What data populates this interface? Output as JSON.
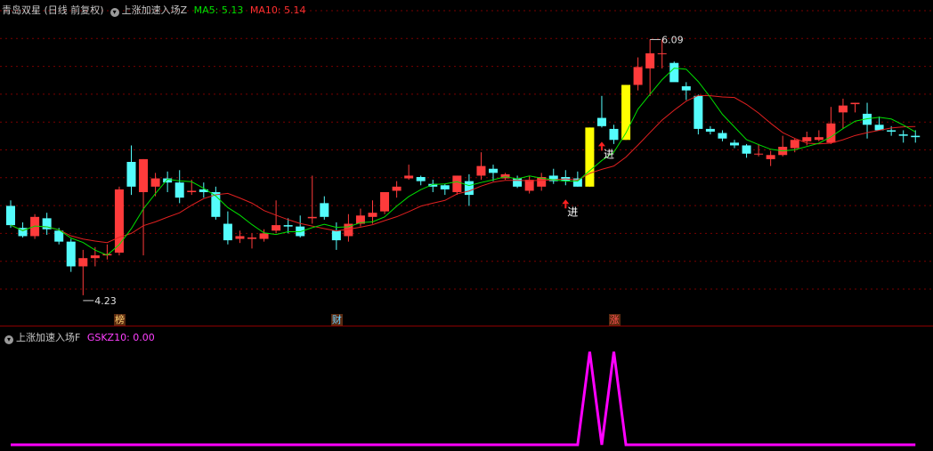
{
  "header": {
    "main_title": "青岛双星 (日线 前复权)",
    "indicator_name": "上涨加速入场Z",
    "ma5_label": "MA5: 5.13",
    "ma10_label": "MA10: 5.14"
  },
  "sub_header": {
    "indicator_name": "上涨加速入场F",
    "value_label": "GSKZ10: 0.00"
  },
  "event_badges": [
    {
      "label": "榜",
      "index": 9,
      "color": "#ffd070"
    },
    {
      "label": "财",
      "index": 27,
      "color": "#6ad0ff"
    },
    {
      "label": "涨",
      "index": 50,
      "color": "#ff5050"
    }
  ],
  "signals": {
    "entry_text": "进",
    "entry_indices": [
      46,
      49
    ]
  },
  "colors": {
    "up": "#ff3b3b",
    "down": "#54fcfc",
    "highlight": "#ffff00",
    "ma5": "#00e000",
    "ma10": "#e02020",
    "grid": "#7a0000",
    "sub_line": "#ff00ff"
  },
  "chart_data": [
    {
      "type": "candlestick",
      "series": [
        {
          "name": "price",
          "ohlc": [
            [
              4.88,
              4.92,
              4.72,
              4.74
            ],
            [
              4.72,
              4.76,
              4.65,
              4.66
            ],
            [
              4.66,
              4.82,
              4.64,
              4.8
            ],
            [
              4.79,
              4.83,
              4.67,
              4.71
            ],
            [
              4.7,
              4.72,
              4.6,
              4.62
            ],
            [
              4.62,
              4.64,
              4.4,
              4.44
            ],
            [
              4.44,
              4.56,
              4.23,
              4.5
            ],
            [
              4.5,
              4.58,
              4.44,
              4.52
            ],
            [
              4.52,
              4.6,
              4.49,
              4.53
            ],
            [
              4.54,
              5.02,
              4.52,
              5.0
            ],
            [
              5.2,
              5.32,
              4.96,
              5.02
            ],
            [
              4.98,
              5.22,
              4.52,
              5.22
            ],
            [
              5.02,
              5.12,
              4.95,
              5.08
            ],
            [
              5.08,
              5.13,
              4.98,
              5.05
            ],
            [
              5.05,
              5.14,
              4.9,
              4.94
            ],
            [
              4.98,
              5.07,
              4.96,
              4.99
            ],
            [
              5.0,
              5.05,
              4.94,
              4.98
            ],
            [
              4.98,
              5.02,
              4.78,
              4.8
            ],
            [
              4.75,
              4.84,
              4.6,
              4.63
            ],
            [
              4.64,
              4.7,
              4.61,
              4.66
            ],
            [
              4.64,
              4.68,
              4.57,
              4.65
            ],
            [
              4.64,
              4.71,
              4.62,
              4.68
            ],
            [
              4.7,
              4.92,
              4.68,
              4.74
            ],
            [
              4.74,
              4.79,
              4.68,
              4.73
            ],
            [
              4.73,
              4.81,
              4.65,
              4.66
            ],
            [
              4.79,
              5.1,
              4.75,
              4.8
            ],
            [
              4.9,
              4.95,
              4.78,
              4.8
            ],
            [
              4.7,
              4.76,
              4.56,
              4.63
            ],
            [
              4.66,
              4.82,
              4.62,
              4.75
            ],
            [
              4.75,
              4.86,
              4.73,
              4.81
            ],
            [
              4.8,
              4.92,
              4.75,
              4.83
            ],
            [
              4.84,
              4.98,
              4.82,
              4.98
            ],
            [
              4.99,
              5.06,
              4.94,
              5.02
            ],
            [
              5.08,
              5.18,
              5.07,
              5.1
            ],
            [
              5.09,
              5.1,
              5.03,
              5.06
            ],
            [
              5.04,
              5.07,
              4.98,
              5.02
            ],
            [
              5.03,
              5.04,
              4.96,
              5.0
            ],
            [
              4.98,
              5.1,
              4.96,
              5.1
            ],
            [
              5.06,
              5.11,
              4.88,
              4.96
            ],
            [
              5.1,
              5.27,
              5.07,
              5.17
            ],
            [
              5.15,
              5.18,
              5.06,
              5.12
            ],
            [
              5.08,
              5.12,
              5.07,
              5.11
            ],
            [
              5.08,
              5.1,
              5.01,
              5.02
            ],
            [
              4.99,
              5.1,
              4.97,
              5.07
            ],
            [
              5.02,
              5.12,
              4.99,
              5.09
            ],
            [
              5.1,
              5.15,
              5.04,
              5.06
            ],
            [
              5.09,
              5.14,
              5.03,
              5.06
            ],
            [
              5.08,
              5.13,
              5.02,
              5.02
            ],
            [
              5.02,
              5.45,
              5.02,
              5.45
            ],
            [
              5.52,
              5.68,
              5.45,
              5.46
            ],
            [
              5.44,
              5.47,
              5.33,
              5.36
            ],
            [
              5.36,
              5.76,
              5.36,
              5.76
            ],
            [
              5.76,
              5.96,
              5.72,
              5.89
            ],
            [
              5.88,
              6.09,
              5.68,
              5.99
            ],
            [
              5.99,
              6.09,
              5.88,
              5.99
            ],
            [
              5.92,
              5.93,
              5.81,
              5.78
            ],
            [
              5.75,
              5.78,
              5.65,
              5.72
            ],
            [
              5.68,
              5.69,
              5.4,
              5.44
            ],
            [
              5.44,
              5.46,
              5.4,
              5.42
            ],
            [
              5.41,
              5.43,
              5.35,
              5.37
            ],
            [
              5.34,
              5.36,
              5.3,
              5.32
            ],
            [
              5.32,
              5.33,
              5.23,
              5.26
            ],
            [
              5.26,
              5.33,
              5.24,
              5.26
            ],
            [
              5.22,
              5.28,
              5.17,
              5.25
            ],
            [
              5.25,
              5.39,
              5.24,
              5.31
            ],
            [
              5.3,
              5.37,
              5.27,
              5.36
            ],
            [
              5.35,
              5.42,
              5.32,
              5.38
            ],
            [
              5.36,
              5.43,
              5.35,
              5.38
            ],
            [
              5.34,
              5.6,
              5.33,
              5.48
            ],
            [
              5.56,
              5.66,
              5.44,
              5.61
            ],
            [
              5.62,
              5.63,
              5.56,
              5.63
            ],
            [
              5.55,
              5.63,
              5.37,
              5.47
            ],
            [
              5.47,
              5.53,
              5.43,
              5.43
            ],
            [
              5.43,
              5.46,
              5.39,
              5.42
            ],
            [
              5.4,
              5.43,
              5.34,
              5.39
            ],
            [
              5.39,
              5.43,
              5.34,
              5.38
            ]
          ]
        },
        {
          "name": "MA5",
          "values": []
        },
        {
          "name": "MA10",
          "values": []
        }
      ],
      "annotations": [
        {
          "text": "4.23",
          "index": 6
        },
        {
          "text": "6.09",
          "index": 53
        }
      ],
      "ylim": [
        4.1,
        6.3
      ]
    },
    {
      "type": "line",
      "series": [
        {
          "name": "GSKZ10",
          "values": [
            0,
            0,
            0,
            0,
            0,
            0,
            0,
            0,
            0,
            0,
            0,
            0,
            0,
            0,
            0,
            0,
            0,
            0,
            0,
            0,
            0,
            0,
            0,
            0,
            0,
            0,
            0,
            0,
            0,
            0,
            0,
            0,
            0,
            0,
            0,
            0,
            0,
            0,
            0,
            0,
            0,
            0,
            0,
            0,
            0,
            0,
            0,
            0,
            10,
            0,
            10,
            0,
            0,
            0,
            0,
            0,
            0,
            0,
            0,
            0,
            0,
            0,
            0,
            0,
            0,
            0,
            0,
            0,
            0,
            0,
            0,
            0,
            0,
            0,
            0,
            0
          ]
        }
      ],
      "ylim": [
        0,
        11
      ]
    }
  ]
}
